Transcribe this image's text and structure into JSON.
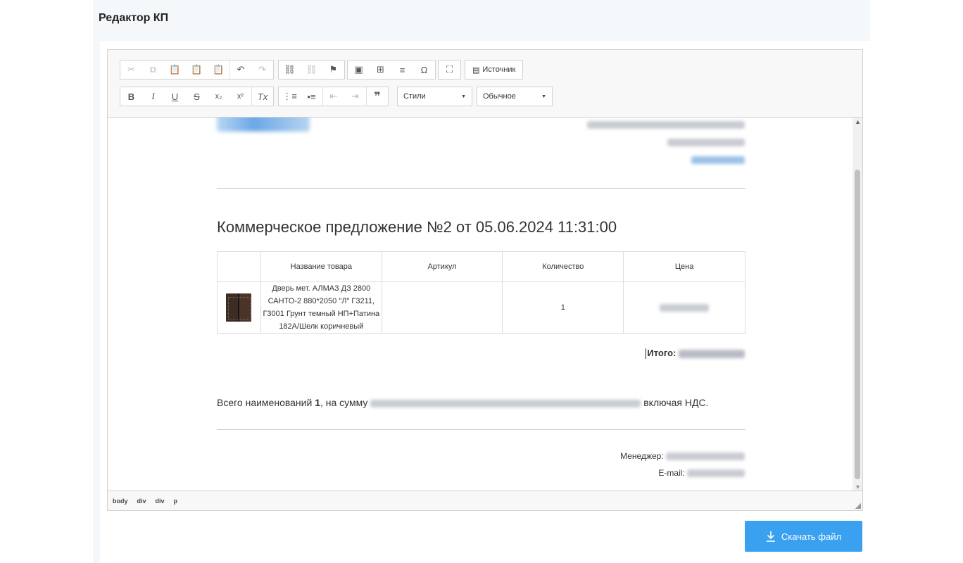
{
  "page": {
    "title": "Редактор КП"
  },
  "toolbar": {
    "source_label": "Источник",
    "styles_combo": "Стили",
    "format_combo": "Обычное"
  },
  "document": {
    "offer_title": "Коммерческое предложение №2 от 05.06.2024 11:31:00",
    "table": {
      "headers": [
        "Название товара",
        "Артикул",
        "Количество",
        "Цена"
      ],
      "rows": [
        {
          "name": "Дверь мет. АЛМАЗ ДЗ 2800 САНТО-2 880*2050 \"Л\" Г3211, Г3001 Грунт темный НП+Патина 182А/Шелк коричневый",
          "article": "",
          "quantity": "1"
        }
      ]
    },
    "total_label": "Итого:",
    "summary": {
      "prefix": "Всего наименований ",
      "count": "1",
      "middle": ", на сумму ",
      "suffix": " включая НДС."
    },
    "manager_label": "Менеджер:",
    "email_label": "E-mail:"
  },
  "statusbar": {
    "path": [
      "body",
      "div",
      "div",
      "p"
    ]
  },
  "download_button": {
    "label": "Скачать файл"
  },
  "colors": {
    "accent": "#3aa1f0",
    "header_band": "#f5f8fa"
  }
}
